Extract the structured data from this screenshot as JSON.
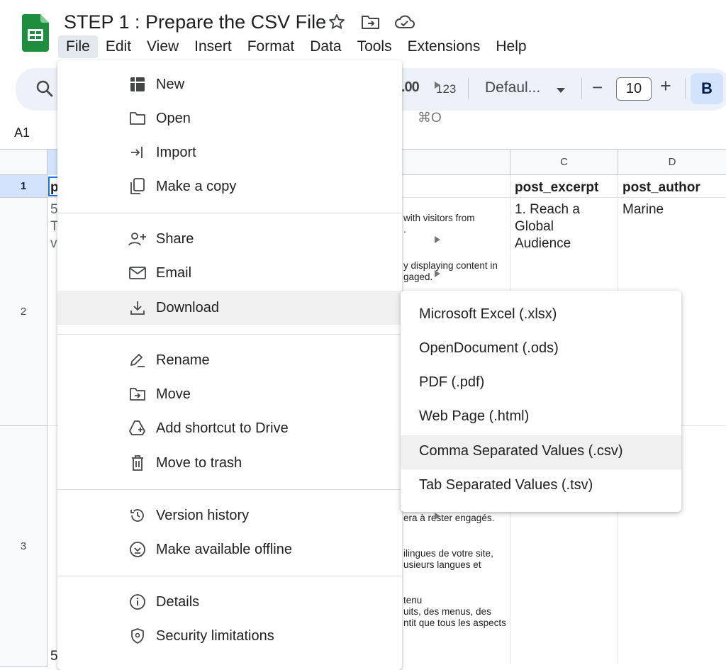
{
  "app": {
    "doc_title": "STEP 1 : Prepare the CSV File",
    "brand_color": "#188038"
  },
  "menubar": {
    "items": [
      "File",
      "Edit",
      "View",
      "Insert",
      "Format",
      "Data",
      "Tools",
      "Extensions",
      "Help"
    ],
    "active": "File"
  },
  "toolbar": {
    "decimal_label": ".00",
    "format_123": "123",
    "font": "Defaul...",
    "font_size": "10",
    "minus": "−",
    "plus": "+",
    "bold": "B"
  },
  "namebox": "A1",
  "sheet": {
    "col_headers": [
      "C",
      "D"
    ],
    "row_headers": [
      "1",
      "2",
      "3"
    ],
    "header_cells": {
      "a_partial": "p",
      "c": "post_excerpt",
      "d": "post_author"
    },
    "row2": {
      "a_fragments": [
        "5",
        "T",
        "v"
      ],
      "b_lines": [
        "with visitors from",
        ".",
        "",
        "y displaying content in",
        "gaged."
      ],
      "c_lines": [
        "1. Reach a",
        "Global",
        "Audience"
      ],
      "d": "Marine"
    },
    "row3": {
      "b_lines": [
        "era à rester engagés.",
        "",
        "",
        "ilingues de votre site,",
        "usieurs langues et",
        "",
        "",
        "tenu",
        "uits, des menus, des",
        "ntit que tous les aspects"
      ],
      "a_bottom": "5"
    }
  },
  "file_menu": {
    "items": [
      {
        "label": "New",
        "icon": "new-sheet-icon",
        "submenu": true
      },
      {
        "label": "Open",
        "icon": "folder-icon",
        "shortcut": "⌘O"
      },
      {
        "label": "Import",
        "icon": "import-icon"
      },
      {
        "label": "Make a copy",
        "icon": "copy-icon"
      },
      {
        "label": "Share",
        "icon": "share-person-icon",
        "submenu": true
      },
      {
        "label": "Email",
        "icon": "email-icon",
        "submenu": true
      },
      {
        "label": "Download",
        "icon": "download-icon",
        "submenu": true,
        "highlighted": true
      },
      {
        "label": "Rename",
        "icon": "rename-icon"
      },
      {
        "label": "Move",
        "icon": "move-folder-icon"
      },
      {
        "label": "Add shortcut to Drive",
        "icon": "drive-shortcut-icon"
      },
      {
        "label": "Move to trash",
        "icon": "trash-icon"
      },
      {
        "label": "Version history",
        "icon": "history-icon",
        "submenu": true
      },
      {
        "label": "Make available offline",
        "icon": "offline-icon"
      },
      {
        "label": "Details",
        "icon": "info-icon"
      },
      {
        "label": "Security limitations",
        "icon": "shield-icon"
      }
    ]
  },
  "download_submenu": {
    "items": [
      "Microsoft Excel (.xlsx)",
      "OpenDocument (.ods)",
      "PDF (.pdf)",
      "Web Page (.html)",
      "Comma Separated Values (.csv)",
      "Tab Separated Values (.tsv)"
    ],
    "highlighted": "Comma Separated Values (.csv)"
  }
}
